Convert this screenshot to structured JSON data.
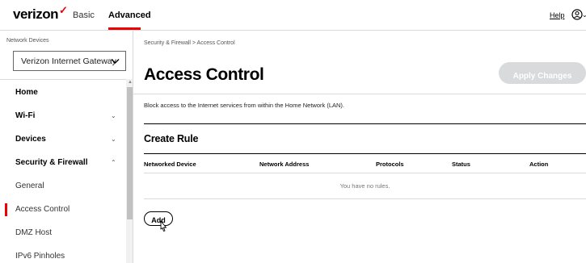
{
  "header": {
    "logo": "verizon",
    "logo_mark": "✓",
    "tabs": [
      {
        "label": "Basic",
        "active": false
      },
      {
        "label": "Advanced",
        "active": true
      }
    ],
    "help_label": "Help",
    "user_caret": "⌄",
    "accent_color": "#ee0000"
  },
  "sidebar": {
    "network_devices_label": "Network Devices",
    "selected_device": "Verizon Internet Gateway",
    "items": [
      {
        "label": "Home",
        "level": "top",
        "chevron": ""
      },
      {
        "label": "Wi-Fi",
        "level": "top",
        "chevron": "⌄"
      },
      {
        "label": "Devices",
        "level": "top",
        "chevron": "⌄"
      },
      {
        "label": "Security & Firewall",
        "level": "top",
        "chevron": "⌃"
      },
      {
        "label": "General",
        "level": "sub",
        "chevron": ""
      },
      {
        "label": "Access Control",
        "level": "sub",
        "chevron": "",
        "active": true
      },
      {
        "label": "DMZ Host",
        "level": "sub",
        "chevron": ""
      },
      {
        "label": "IPv6 Pinholes",
        "level": "sub",
        "chevron": ""
      }
    ],
    "scroll_up_glyph": "▲"
  },
  "main": {
    "breadcrumb": "Security & Firewall  >  Access Control",
    "title": "Access Control",
    "apply_label": "Apply Changes",
    "description": "Block access to the Internet services from within the Home Network (LAN).",
    "create_rule_title": "Create Rule",
    "table": {
      "columns": [
        "Networked Device",
        "Network Address",
        "Protocols",
        "Status",
        "Action"
      ],
      "empty_message": "You have no rules."
    },
    "add_label": "Add"
  }
}
